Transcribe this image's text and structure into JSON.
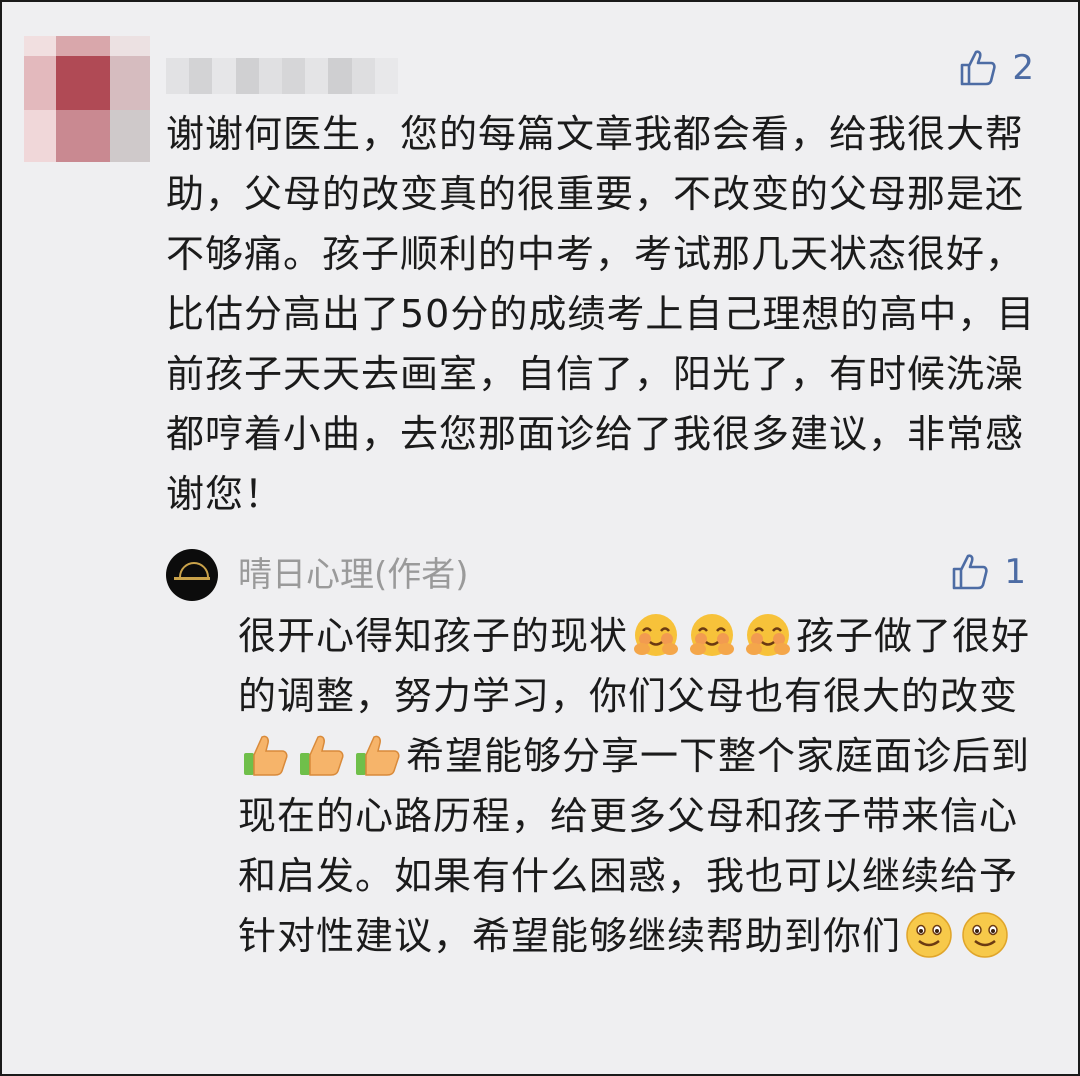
{
  "comment": {
    "likes": "2",
    "text": "谢谢何医生，您的每篇文章我都会看，给我很大帮助，父母的改变真的很重要，不改变的父母那是还不够痛。孩子顺利的中考，考试那几天状态很好，比估分高出了50分的成绩考上自己理想的高中，目前孩子天天去画室，自信了，阳光了，有时候洗澡都哼着小曲，去您那面诊给了我很多建议，非常感谢您！"
  },
  "reply": {
    "author": "晴日心理(作者)",
    "likes": "1",
    "text_1": "很开心得知孩子的现状",
    "text_2": "孩子做了很好的调整，努力学习，你们父母也有很大的改变",
    "text_3": "希望能够分享一下整个家庭面诊后到现在的心路历程，给更多父母和孩子带来信心和启发。如果有什么困惑，我也可以继续给予针对性建议，希望能够继续帮助到你们",
    "emojis_1": [
      "blush-emoji",
      "blush-emoji",
      "blush-emoji"
    ],
    "emojis_2": [
      "thumbs-up-emoji",
      "thumbs-up-emoji",
      "thumbs-up-emoji"
    ],
    "emojis_3": [
      "smile-emoji",
      "smile-emoji"
    ]
  },
  "icons": {
    "like": "thumb-up-icon"
  },
  "colors": {
    "background": "#efeff1",
    "like": "#4d6ca4",
    "author": "#9a9a9a",
    "text": "#1b1b1b",
    "avatar_gold": "#c9a24a"
  }
}
